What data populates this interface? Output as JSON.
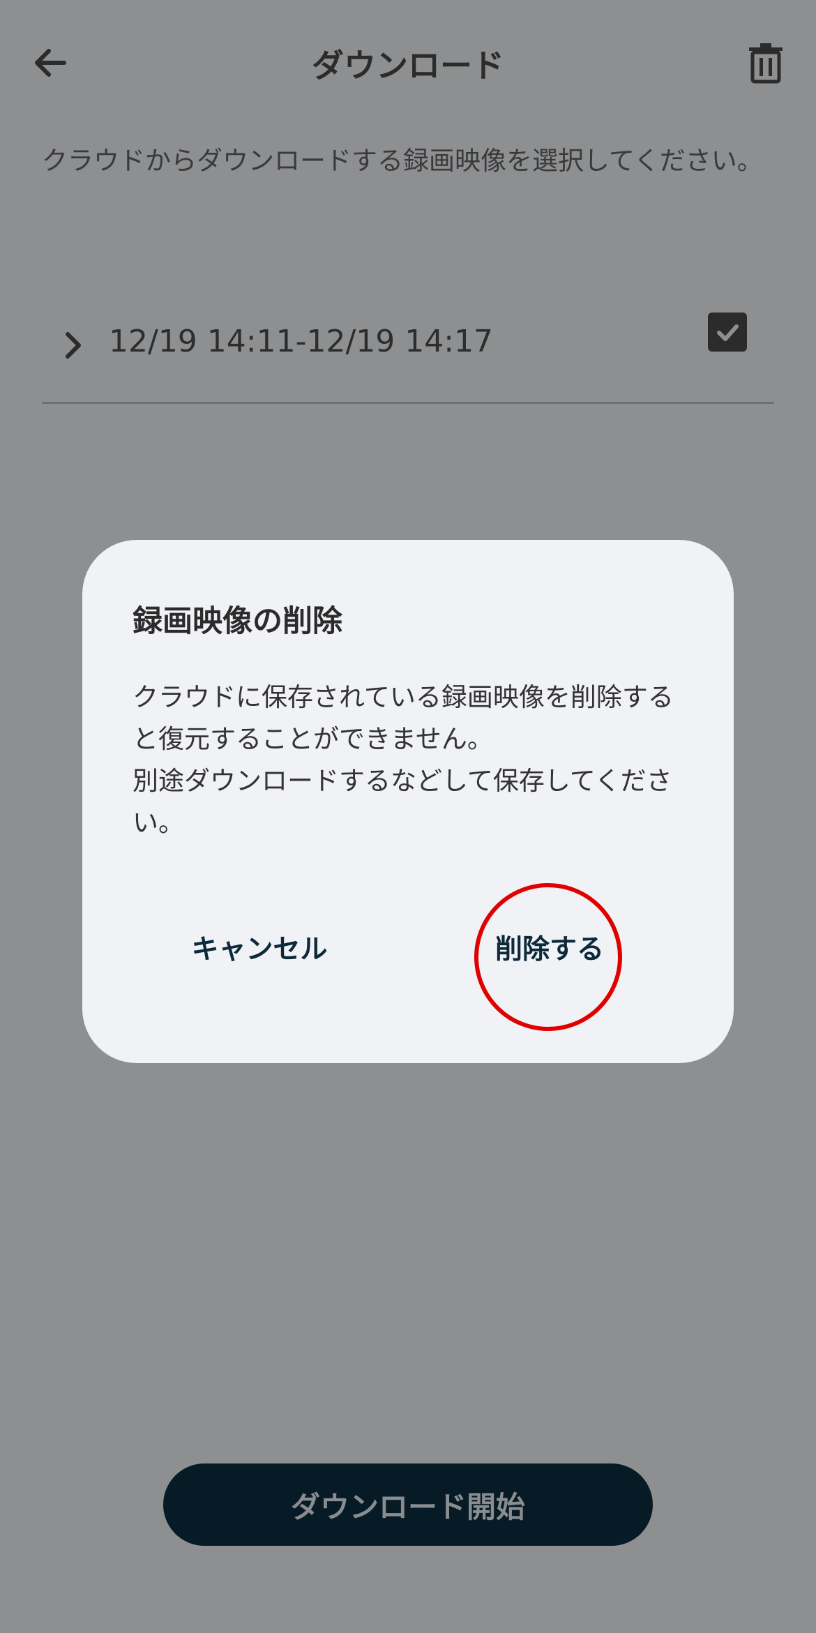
{
  "header": {
    "title": "ダウンロード",
    "back_icon": "arrow-left-icon",
    "trash_icon": "trash-icon"
  },
  "instruction": "クラウドからダウンロードする録画映像を選択してください。",
  "records": [
    {
      "label": "12/19 14:11-12/19 14:17",
      "checked": true
    }
  ],
  "dialog": {
    "title": "録画映像の削除",
    "body_line1": "クラウドに保存されている録画映像を削除すると復元することができません。",
    "body_line2": "別途ダウンロードするなどして保存してください。",
    "cancel_label": "キャンセル",
    "delete_label": "削除する"
  },
  "download_button": {
    "label": "ダウンロード開始"
  },
  "colors": {
    "background": "#8e8f91",
    "dialog_bg": "#f1f2f6",
    "button_dark": "#061b26",
    "highlight": "#e10000"
  }
}
